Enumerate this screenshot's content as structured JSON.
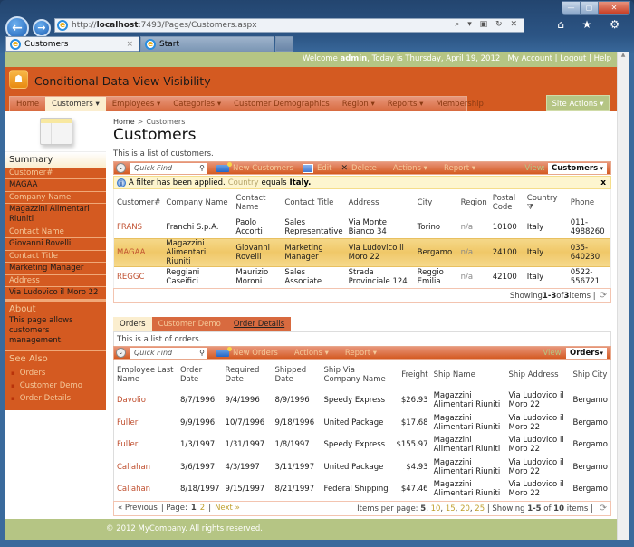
{
  "browser": {
    "url_prefix": "http://",
    "url_host": "localhost",
    "url_rest": ":7493/Pages/Customers.aspx",
    "tabs": [
      {
        "label": "Customers",
        "active": true
      },
      {
        "label": "Start",
        "active": false
      }
    ],
    "address_tools": "⌕ ▾ ▣ ↻ ✕",
    "toolbar_icons": "⌂ ★ ⚙",
    "close_tab": "×",
    "window_controls": {
      "minimize": "—",
      "maximize": "▢",
      "close": "✕"
    }
  },
  "topbar": {
    "welcome_prefix": "Welcome ",
    "user": "admin",
    "today_text": ", Today is Thursday, April 19, 2012 | ",
    "my_account": "My Account",
    "logout": "Logout",
    "help": "Help",
    "sep": " | "
  },
  "header": {
    "app_title": "Conditional Data View Visibility",
    "logo_glyph": "☗"
  },
  "menu": {
    "items": [
      {
        "label": "Home"
      },
      {
        "label": "Customers ▾",
        "selected": true
      },
      {
        "label": "Employees ▾"
      },
      {
        "label": "Categories ▾"
      },
      {
        "label": "Customer Demographics"
      },
      {
        "label": "Region ▾"
      },
      {
        "label": "Reports ▾"
      },
      {
        "label": "Membership"
      }
    ],
    "site_actions": "Site Actions ▾"
  },
  "sidebar": {
    "summary_title": "Summary",
    "fields": [
      {
        "label": "Customer#",
        "value": "MAGAA"
      },
      {
        "label": "Company Name",
        "value": "Magazzini Alimentari Riuniti"
      },
      {
        "label": "Contact Name",
        "value": "Giovanni Rovelli"
      },
      {
        "label": "Contact Title",
        "value": "Marketing Manager"
      },
      {
        "label": "Address",
        "value": "Via Ludovico il Moro 22"
      }
    ],
    "about_title": "About",
    "about_text": "This page allows customers management.",
    "see_also_title": "See Also",
    "see_also": [
      "Orders",
      "Customer Demo",
      "Order Details"
    ]
  },
  "main": {
    "breadcrumb": {
      "home": "Home",
      "sep": ">",
      "current": "Customers"
    },
    "title": "Customers",
    "description": "This is a list of customers.",
    "toolbar": {
      "quick_find_placeholder": "Quick Find",
      "new_label": "New Customers",
      "edit_label": "Edit",
      "delete_label": "Delete",
      "actions_label": "Actions ▾",
      "report_label": "Report ▾",
      "view_label": "View:",
      "view_value": "Customers"
    },
    "filter": {
      "prefix": "A filter has been applied.",
      "field": "Country",
      "op": "equals",
      "value": "Italy.",
      "close": "x"
    },
    "columns": [
      "Customer#",
      "Company Name",
      "Contact Name",
      "Contact Title",
      "Address",
      "City",
      "Region",
      "Postal Code",
      "Country",
      "Phone"
    ],
    "rows": [
      [
        "FRANS",
        "Franchi S.p.A.",
        "Paolo Accorti",
        "Sales Representative",
        "Via Monte Bianco 34",
        "Torino",
        "n/a",
        "10100",
        "Italy",
        "011-4988260"
      ],
      [
        "MAGAA",
        "Magazzini Alimentari Riuniti",
        "Giovanni Rovelli",
        "Marketing Manager",
        "Via Ludovico il Moro 22",
        "Bergamo",
        "n/a",
        "24100",
        "Italy",
        "035-640230"
      ],
      [
        "REGGC",
        "Reggiani Caseifici",
        "Maurizio Moroni",
        "Sales Associate",
        "Strada Provinciale 124",
        "Reggio Emilia",
        "n/a",
        "42100",
        "Italy",
        "0522-556721"
      ]
    ],
    "selected_row": 1,
    "pager": {
      "showing": "Showing ",
      "range": "1-3",
      "of": " of ",
      "total": "3",
      "items": " items |"
    }
  },
  "orders": {
    "tabs": [
      {
        "label": "Orders",
        "active": true
      },
      {
        "label": "Customer Demo"
      },
      {
        "label": "Order Details",
        "underline": true
      }
    ],
    "description": "This is a list of orders.",
    "toolbar": {
      "quick_find_placeholder": "Quick Find",
      "new_label": "New Orders",
      "actions_label": "Actions ▾",
      "report_label": "Report ▾",
      "view_label": "View:",
      "view_value": "Orders"
    },
    "columns": [
      "Employee Last Name",
      "Order Date",
      "Required Date",
      "Shipped Date",
      "Ship Via Company Name",
      "Freight",
      "Ship Name",
      "Ship Address",
      "Ship City"
    ],
    "rows": [
      [
        "Davolio",
        "8/7/1996",
        "9/4/1996",
        "8/9/1996",
        "Speedy Express",
        "$26.93",
        "Magazzini Alimentari Riuniti",
        "Via Ludovico il Moro 22",
        "Bergamo"
      ],
      [
        "Fuller",
        "9/9/1996",
        "10/7/1996",
        "9/18/1996",
        "United Package",
        "$17.68",
        "Magazzini Alimentari Riuniti",
        "Via Ludovico il Moro 22",
        "Bergamo"
      ],
      [
        "Fuller",
        "1/3/1997",
        "1/31/1997",
        "1/8/1997",
        "Speedy Express",
        "$155.97",
        "Magazzini Alimentari Riuniti",
        "Via Ludovico il Moro 22",
        "Bergamo"
      ],
      [
        "Callahan",
        "3/6/1997",
        "4/3/1997",
        "3/11/1997",
        "United Package",
        "$4.93",
        "Magazzini Alimentari Riuniti",
        "Via Ludovico il Moro 22",
        "Bergamo"
      ],
      [
        "Callahan",
        "8/18/1997",
        "9/15/1997",
        "8/21/1997",
        "Federal Shipping",
        "$47.46",
        "Magazzini Alimentari Riuniti",
        "Via Ludovico il Moro 22",
        "Bergamo"
      ]
    ],
    "pager": {
      "previous": "« Previous",
      "page_label": "| Page:",
      "current_page": "1",
      "other_page": "2",
      "next": "Next »",
      "per_page_label": "Items per page:",
      "per_page_current": "5",
      "per_page_options": [
        "10",
        "15",
        "20",
        "25"
      ],
      "showing": "| Showing ",
      "range": "1-5",
      "of": " of ",
      "total": "10",
      "items": " items |"
    }
  },
  "footer": {
    "text": "© 2012 MyCompany. All rights reserved."
  }
}
